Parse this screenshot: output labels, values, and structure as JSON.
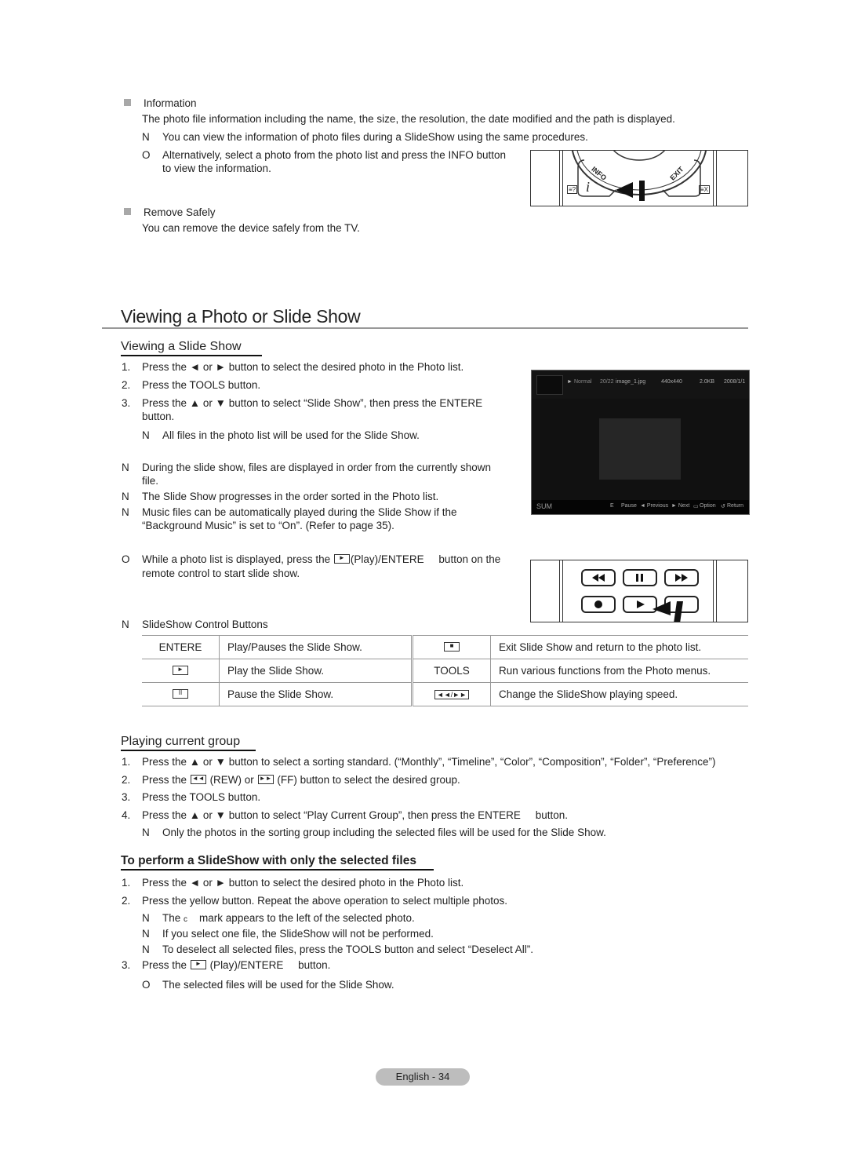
{
  "info_section": {
    "title": "Information",
    "body": "The photo file information including the name, the size, the resolution, the date modified and the path is displayed.",
    "note_marker": "N",
    "note": "You can view the information of photo files during a SlideShow using the same procedures.",
    "tip_marker": "O",
    "tip_line1": "Alternatively, select a photo from the photo list and press the INFO button",
    "tip_line2": "to view the information."
  },
  "remote_info": {
    "info_label": "INFO",
    "exit_label": "EXIT",
    "i_glyph": "i",
    "left_icon": "≡?",
    "right_icon": "≡X"
  },
  "remove_section": {
    "title": "Remove Safely",
    "body": "You can remove the device safely from the TV."
  },
  "main_title": "Viewing a Photo or Slide Show",
  "slideshow": {
    "heading": "Viewing a Slide Show",
    "steps": [
      {
        "num": "1.",
        "text": "Press the ◄ or ► button to select the desired photo in the Photo list."
      },
      {
        "num": "2.",
        "text": "Press the TOOLS button."
      },
      {
        "num": "3.",
        "text": "Press the ▲ or ▼ button to select “Slide Show”, then press the ENTERE",
        "cont": "button."
      }
    ],
    "step3_note": "All files in the photo list will be used for the Slide Show.",
    "notes": [
      {
        "line1": "During the slide show, files are displayed in order from the currently shown",
        "line2": "file."
      },
      {
        "line1": "The Slide Show progresses in the order sorted in the Photo list.",
        "line2": ""
      },
      {
        "line1": "Music files can be automatically played during the Slide Show if the",
        "line2": "“Background Music” is set to “On”. (Refer to page 35)."
      }
    ],
    "tip_pre": "While a photo list is displayed, press the",
    "tip_mid": "(Play)/ENTERE",
    "tip_post": "button on the",
    "tip_line2": "remote control to start slide show.",
    "controls_heading": "SlideShow Control Buttons"
  },
  "tv_screen": {
    "mode": "Normal",
    "counter": "20/22",
    "filename": "image_1.jpg",
    "resolution": "440x440",
    "size": "2.0KB",
    "date": "2008/1/1",
    "device": "SUM",
    "hints": [
      "E",
      "Pause",
      "◄ Previous",
      "► Next",
      "Option",
      "Return"
    ]
  },
  "control_table": [
    {
      "key": "ENTERE",
      "desc": "Play/Pauses the Slide Show.",
      "key2_icon": "■",
      "desc2": "Exit Slide Show and return to the photo list."
    },
    {
      "key_icon": "►",
      "desc": "Play the Slide Show.",
      "key2": "TOOLS",
      "desc2": "Run various functions from the Photo menus."
    },
    {
      "key_icon": "II",
      "desc": "Pause the Slide Show.",
      "key2_icon": "◄◄/►►",
      "desc2": "Change the SlideShow playing speed."
    }
  ],
  "group": {
    "heading": "Playing current group",
    "steps": [
      {
        "num": "1.",
        "text": "Press the ▲ or ▼ button to select a sorting standard. (“Monthly”, “Timeline”, “Color”, “Composition”, “Folder”, “Preference”)"
      },
      {
        "num": "2.",
        "pre": "Press the",
        "mid": "(REW) or",
        "post": "(FF) button to select the desired group."
      },
      {
        "num": "3.",
        "text": "Press the TOOLS button."
      },
      {
        "num": "4.",
        "text": "Press the ▲ or ▼ button to select “Play Current Group”, then press the ENTERE",
        "post": "button."
      }
    ],
    "note": "Only the photos in the sorting group including the selected files will be used for the Slide Show."
  },
  "selected": {
    "heading": "To perform a SlideShow with only the selected files",
    "steps": [
      {
        "num": "1.",
        "text": "Press the ◄ or ► button to select the desired photo in the Photo list."
      },
      {
        "num": "2.",
        "text": "Press the yellow button. Repeat the above operation to select multiple photos."
      }
    ],
    "notes": [
      {
        "pre": "The",
        "mark": "c",
        "post": "mark appears to the left of the selected photo."
      },
      {
        "text": "If you select one file, the SlideShow will not be performed."
      },
      {
        "text": "To deselect all selected files, press the TOOLS button and select “Deselect All”."
      }
    ],
    "step3_num": "3.",
    "step3_pre": "Press the",
    "step3_mid": "(Play)/ENTERE",
    "step3_post": "button.",
    "tip": "The selected files will be used for the Slide Show."
  },
  "markers": {
    "note": "N",
    "tip": "O"
  },
  "footer": "English - 34"
}
